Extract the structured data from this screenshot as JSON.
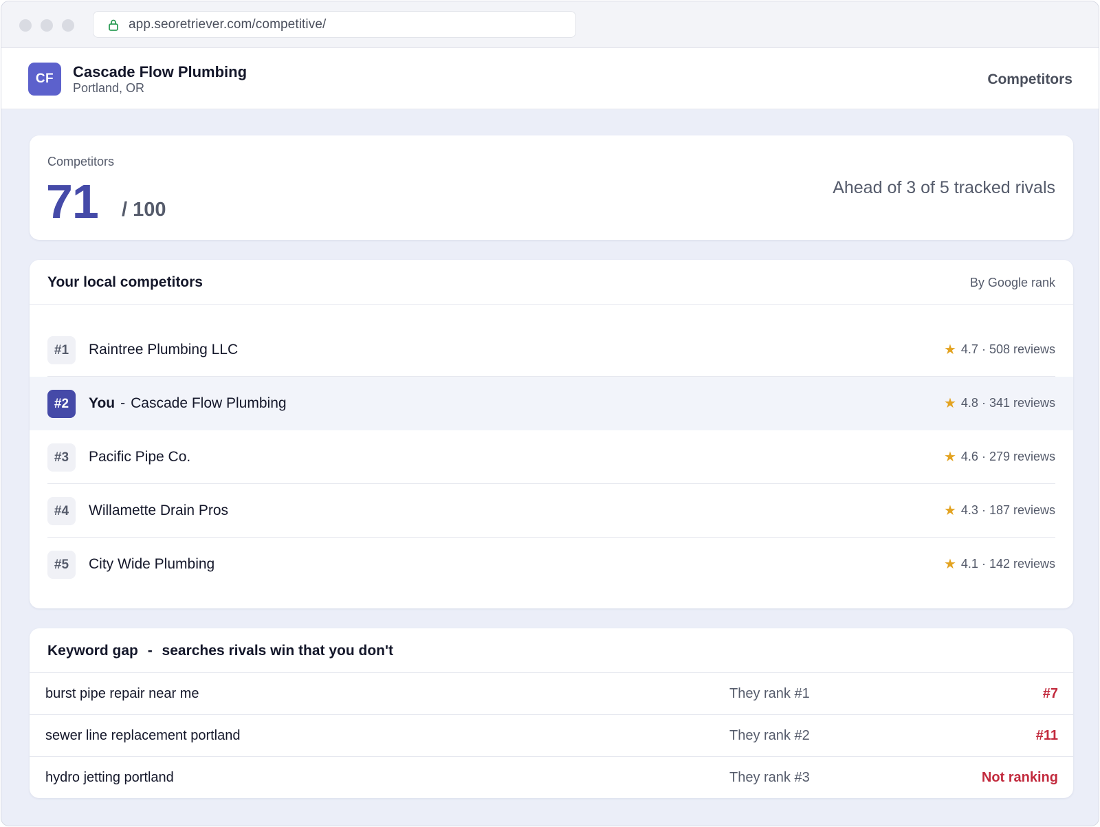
{
  "browser": {
    "url": "app.seoretriever.com/competitive/"
  },
  "header": {
    "logo_initials": "CF",
    "business_name": "Cascade Flow Plumbing",
    "location": "Portland, OR",
    "nav_label": "Competitors"
  },
  "score": {
    "label": "Competitors",
    "value": "71",
    "max": "/ 100",
    "summary": "Ahead of 3 of 5 tracked rivals"
  },
  "competitors": {
    "title": "Your local competitors",
    "sort_label": "By Google rank",
    "you_label": "You",
    "you_separator": "-",
    "rows": [
      {
        "rank": "#1",
        "name": "Raintree Plumbing LLC",
        "rating": "4.7 · 508 reviews",
        "is_you": false
      },
      {
        "rank": "#2",
        "name": "Cascade Flow Plumbing",
        "rating": "4.8 · 341 reviews",
        "is_you": true
      },
      {
        "rank": "#3",
        "name": "Pacific Pipe Co.",
        "rating": "4.6 · 279 reviews",
        "is_you": false
      },
      {
        "rank": "#4",
        "name": "Willamette Drain Pros",
        "rating": "4.3 · 187 reviews",
        "is_you": false
      },
      {
        "rank": "#5",
        "name": "City Wide Plumbing",
        "rating": "4.1 · 142 reviews",
        "is_you": false
      }
    ]
  },
  "keyword_gap": {
    "title": "Keyword gap",
    "title_separator": "-",
    "subtitle": "searches rivals win that you don't",
    "rows": [
      {
        "term": "burst pipe repair near me",
        "they": "They rank #1",
        "you": "#7"
      },
      {
        "term": "sewer line replacement portland",
        "they": "They rank #2",
        "you": "#11"
      },
      {
        "term": "hydro jetting portland",
        "they": "They rank #3",
        "you": "Not ranking"
      }
    ]
  },
  "colors": {
    "accent": "#454aa8",
    "logo": "#5c61cc",
    "star": "#e3a321",
    "negative": "#c22a3d"
  },
  "icons": {
    "lock": "lock-icon",
    "star": "star-icon"
  }
}
